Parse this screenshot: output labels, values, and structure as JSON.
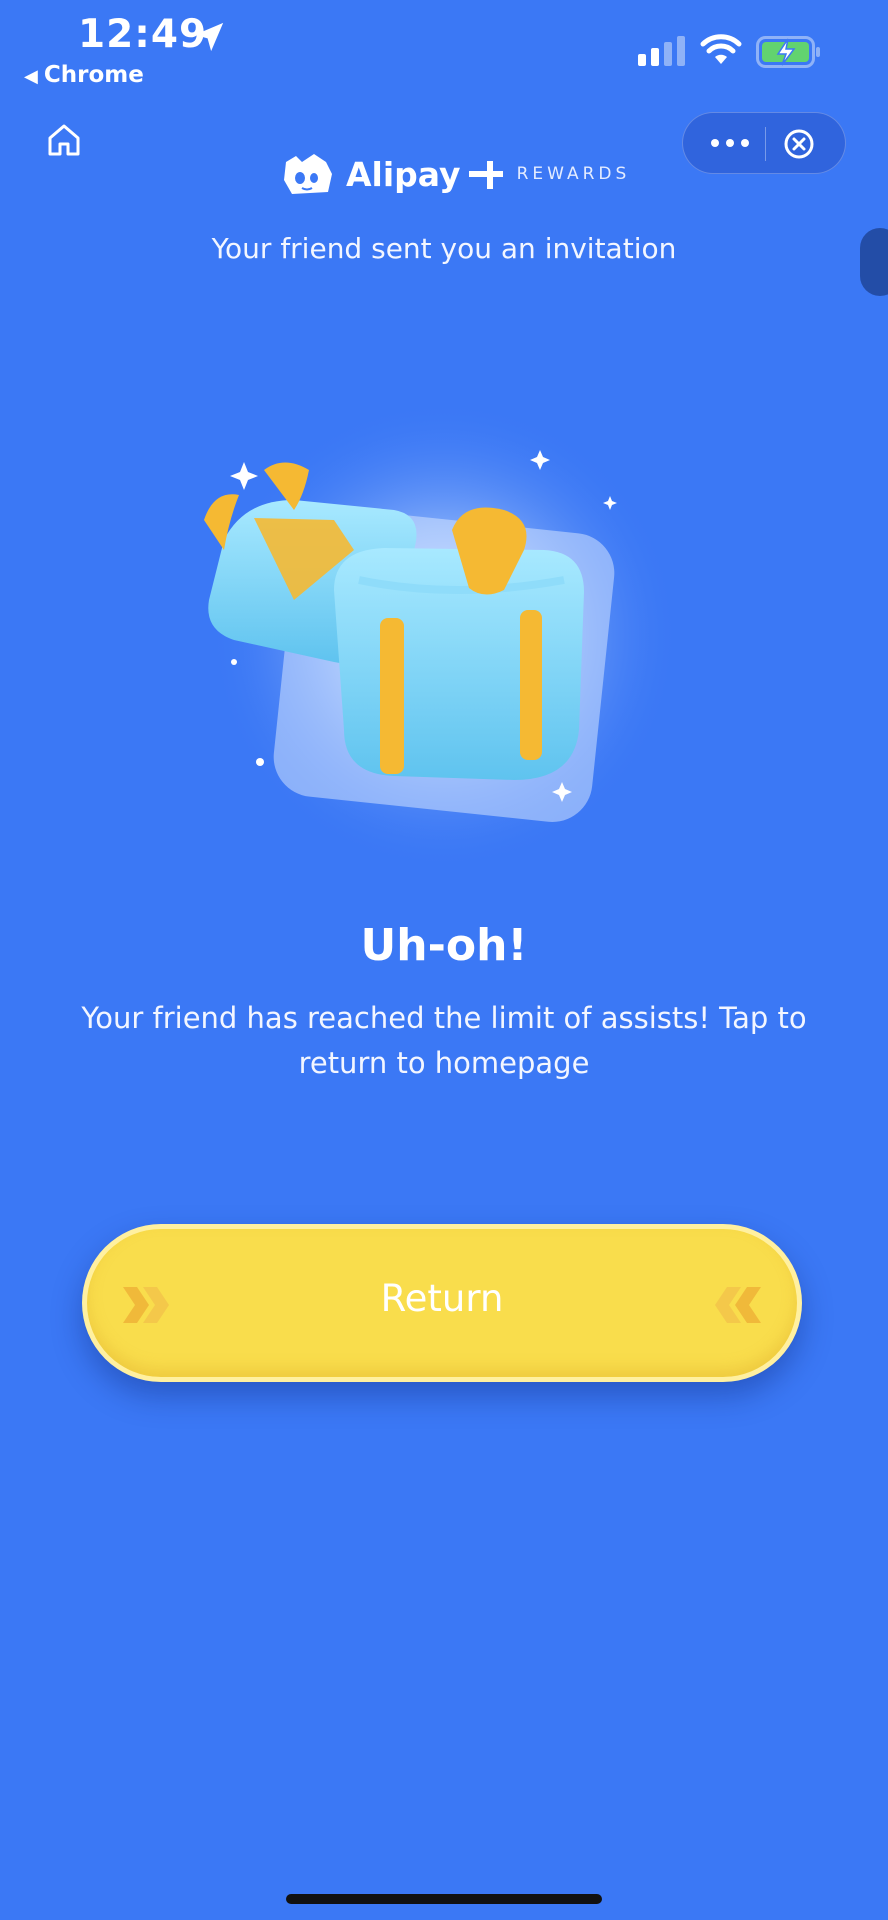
{
  "status_bar": {
    "time": "12:49",
    "back_app": "Chrome",
    "icons": [
      "location-arrow-icon",
      "cellular-signal-icon",
      "wifi-icon",
      "battery-charging-icon"
    ]
  },
  "nav": {
    "icons": [
      "home-icon",
      "more-dots-icon",
      "close-circle-icon"
    ]
  },
  "brand": {
    "name": "Alipay",
    "tagline": "REWARDS"
  },
  "invite_text": "Your friend sent you an invitation",
  "result": {
    "title": "Uh-oh!",
    "message": "Your friend has reached the limit of assists! Tap to return to homepage"
  },
  "return_button": {
    "label": "Return"
  },
  "colors": {
    "background": "#3b78f5",
    "button": "#f9dd4c",
    "gift_body": "#7fd8f6",
    "ribbon": "#f5b933",
    "battery": "#62d36f"
  }
}
